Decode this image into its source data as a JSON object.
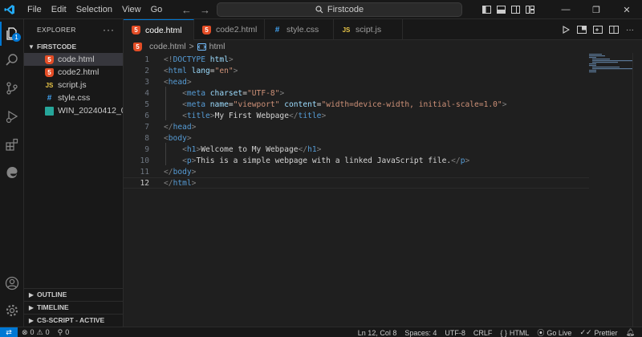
{
  "menu": [
    "File",
    "Edit",
    "Selection",
    "View",
    "Go"
  ],
  "nav": {
    "back_icon": "←",
    "forward_icon": "→"
  },
  "search": {
    "text": "Firstcode"
  },
  "window_controls": {
    "minimize": "—",
    "restore": "❐",
    "close": "✕"
  },
  "activity": {
    "explorer_badge": "1"
  },
  "explorer": {
    "title": "EXPLORER",
    "more": "···",
    "folder": "FIRSTCODE",
    "files": [
      {
        "name": "code.html",
        "type": "html",
        "selected": true
      },
      {
        "name": "code2.html",
        "type": "html",
        "selected": false
      },
      {
        "name": "script.js",
        "type": "js",
        "selected": false
      },
      {
        "name": "style.css",
        "type": "css",
        "selected": false
      },
      {
        "name": "WIN_20240412_0...",
        "type": "img",
        "selected": false
      }
    ],
    "sections": [
      "OUTLINE",
      "TIMELINE",
      "CS-SCRIPT - ACTIVE"
    ]
  },
  "tabs": [
    {
      "label": "code.html",
      "type": "html",
      "active": true,
      "modified": true
    },
    {
      "label": "code2.html",
      "type": "html",
      "active": false,
      "modified": false
    },
    {
      "label": "style.css",
      "type": "css",
      "active": false,
      "modified": false
    },
    {
      "label": "scipt.js",
      "type": "js",
      "active": false,
      "modified": false
    }
  ],
  "breadcrumb": {
    "file": "code.html",
    "separator": ">",
    "symbol": "html"
  },
  "editor": {
    "current_line": 12,
    "lines": [
      {
        "n": "1",
        "indent": 0,
        "tokens": [
          [
            "pn",
            "<!"
          ],
          [
            "tg",
            "DOCTYPE"
          ],
          [
            "tx",
            " "
          ],
          [
            "at",
            "html"
          ],
          [
            "pn",
            ">"
          ]
        ]
      },
      {
        "n": "2",
        "indent": 0,
        "tokens": [
          [
            "pn",
            "<"
          ],
          [
            "tg",
            "html"
          ],
          [
            "tx",
            " "
          ],
          [
            "at",
            "lang"
          ],
          [
            "tx",
            "="
          ],
          [
            "st",
            "\"en\""
          ],
          [
            "pn",
            ">"
          ]
        ]
      },
      {
        "n": "3",
        "indent": 0,
        "tokens": [
          [
            "pn",
            "<"
          ],
          [
            "tg",
            "head"
          ],
          [
            "pn",
            ">"
          ]
        ]
      },
      {
        "n": "4",
        "indent": 1,
        "tokens": [
          [
            "pn",
            "<"
          ],
          [
            "tg",
            "meta"
          ],
          [
            "tx",
            " "
          ],
          [
            "at",
            "charset"
          ],
          [
            "tx",
            "="
          ],
          [
            "st",
            "\"UTF-8\""
          ],
          [
            "pn",
            ">"
          ]
        ]
      },
      {
        "n": "5",
        "indent": 1,
        "tokens": [
          [
            "pn",
            "<"
          ],
          [
            "tg",
            "meta"
          ],
          [
            "tx",
            " "
          ],
          [
            "at",
            "name"
          ],
          [
            "tx",
            "="
          ],
          [
            "st",
            "\"viewport\""
          ],
          [
            "tx",
            " "
          ],
          [
            "at",
            "content"
          ],
          [
            "tx",
            "="
          ],
          [
            "st",
            "\"width=device-width, initial-scale=1.0\""
          ],
          [
            "pn",
            ">"
          ]
        ]
      },
      {
        "n": "6",
        "indent": 1,
        "tokens": [
          [
            "pn",
            "<"
          ],
          [
            "tg",
            "title"
          ],
          [
            "pn",
            ">"
          ],
          [
            "tx",
            "My First Webpage"
          ],
          [
            "pn",
            "</"
          ],
          [
            "tg",
            "title"
          ],
          [
            "pn",
            ">"
          ]
        ]
      },
      {
        "n": "7",
        "indent": 0,
        "tokens": [
          [
            "pn",
            "</"
          ],
          [
            "tg",
            "head"
          ],
          [
            "pn",
            ">"
          ]
        ]
      },
      {
        "n": "8",
        "indent": 0,
        "tokens": [
          [
            "pn",
            "<"
          ],
          [
            "tg",
            "body"
          ],
          [
            "pn",
            ">"
          ]
        ]
      },
      {
        "n": "9",
        "indent": 1,
        "tokens": [
          [
            "pn",
            "<"
          ],
          [
            "tg",
            "h1"
          ],
          [
            "pn",
            ">"
          ],
          [
            "tx",
            "Welcome to My Webpage"
          ],
          [
            "pn",
            "</"
          ],
          [
            "tg",
            "h1"
          ],
          [
            "pn",
            ">"
          ]
        ]
      },
      {
        "n": "10",
        "indent": 1,
        "tokens": [
          [
            "pn",
            "<"
          ],
          [
            "tg",
            "p"
          ],
          [
            "pn",
            ">"
          ],
          [
            "tx",
            "This is a simple webpage with a linked JavaScript file."
          ],
          [
            "pn",
            "</"
          ],
          [
            "tg",
            "p"
          ],
          [
            "pn",
            ">"
          ]
        ]
      },
      {
        "n": "11",
        "indent": 0,
        "tokens": [
          [
            "pn",
            "</"
          ],
          [
            "tg",
            "body"
          ],
          [
            "pn",
            ">"
          ]
        ]
      },
      {
        "n": "12",
        "indent": 0,
        "tokens": [
          [
            "pn",
            "</"
          ],
          [
            "tg",
            "html"
          ],
          [
            "pn",
            ">"
          ]
        ]
      }
    ]
  },
  "status": {
    "remote_icon": "⇄",
    "errors": "0",
    "warnings": "0",
    "ports": "0",
    "position": "Ln 12, Col 8",
    "spaces": "Spaces: 4",
    "encoding": "UTF-8",
    "eol": "CRLF",
    "language_braces": "{ }",
    "language": "HTML",
    "golive": "Go Live",
    "prettier": "Prettier"
  },
  "colors": {
    "accent": "#0078d4",
    "html_icon": "#e44d26",
    "css_icon": "#42a5f5",
    "js_icon": "#e8c547",
    "tag": "#569cd6",
    "attr": "#9cdcfe",
    "string": "#ce9178"
  }
}
